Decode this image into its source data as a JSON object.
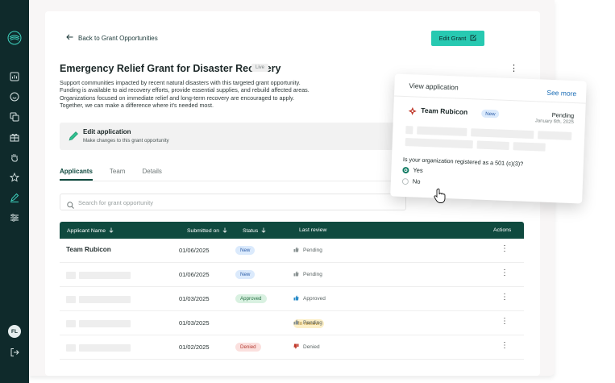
{
  "sidebar": {
    "logo_icon": "spiral-logo-icon",
    "nav_icons": [
      "dashboard-icon",
      "smile-icon",
      "copy-icon",
      "gift-icon",
      "hand-icon",
      "star-icon",
      "pencil-icon",
      "sliders-icon"
    ],
    "avatar_initials": "FL",
    "logout_icon": "logout-icon"
  },
  "header": {
    "back_label": "Back to Grant Opportunities",
    "edit_grant_label": "Edit Grant"
  },
  "grant": {
    "title": "Emergency Relief Grant for Disaster Recovery",
    "status_badge": "Live",
    "description_lines": [
      "Support communities impacted by recent natural disasters with this targeted grant opportunity.",
      "Funding is available to aid recovery efforts, provide essential supplies, and rebuild affected areas.",
      "Organizations focused on immediate relief and long-term recovery are encouraged to apply.",
      "Together, we can make a difference where it's needed most."
    ]
  },
  "edit_application": {
    "title": "Edit application",
    "subtitle": "Make changes to this grant opportunity"
  },
  "tabs": [
    {
      "label": "Applicants",
      "active": true
    },
    {
      "label": "Team",
      "active": false
    },
    {
      "label": "Details",
      "active": false
    }
  ],
  "search": {
    "placeholder": "Search for grant opportunity"
  },
  "table": {
    "headers": {
      "name": "Applicant Name",
      "submitted": "Submitted on",
      "status": "Status",
      "review": "Last review",
      "actions": "Actions"
    },
    "rows": [
      {
        "name": "Team Rubicon",
        "date": "01/06/2025",
        "status": "New",
        "status_kind": "new",
        "review": "Pending",
        "review_icon": "thumb-neutral-icon"
      },
      {
        "name": "",
        "date": "01/06/2025",
        "status": "New",
        "status_kind": "new",
        "review": "Pending",
        "review_icon": "thumb-neutral-icon"
      },
      {
        "name": "",
        "date": "01/03/2025",
        "status": "Approved",
        "status_kind": "approved",
        "review": "Approved",
        "review_icon": "thumb-up-icon"
      },
      {
        "name": "",
        "date": "01/03/2025",
        "status": "In review",
        "status_kind": "review",
        "review": "Pending",
        "review_icon": "thumb-neutral-icon"
      },
      {
        "name": "",
        "date": "01/02/2025",
        "status": "Denied",
        "status_kind": "denied",
        "review": "Denied",
        "review_icon": "thumb-down-icon"
      }
    ]
  },
  "application_card": {
    "title": "View application",
    "see_more": "See more",
    "team_name": "Team Rubicon",
    "badge": "New",
    "status": "Pending",
    "date": "January 6th, 2025",
    "question": "Is your organization registered as a 501 (c)(3)?",
    "options": [
      {
        "label": "Yes",
        "checked": true
      },
      {
        "label": "No",
        "checked": false
      }
    ]
  },
  "colors": {
    "sidebar": "#0f2a2b",
    "accent": "#27c9b1",
    "table_header": "#0f4a3f",
    "link": "#1e6fb7"
  }
}
